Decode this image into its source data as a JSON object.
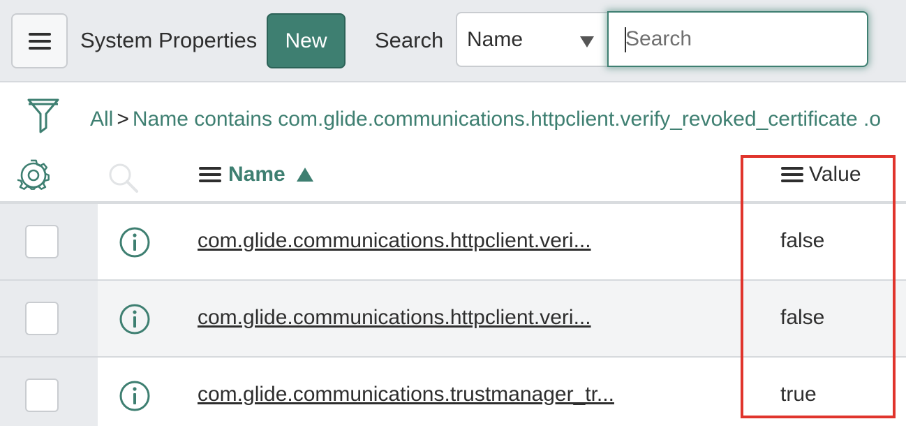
{
  "header": {
    "menu_icon": "hamburger-menu-icon",
    "title": "System Properties",
    "new_label": "New",
    "search_label": "Search",
    "search_field": {
      "selected": "Name"
    },
    "search_input": {
      "value": "",
      "placeholder": "Search"
    }
  },
  "breadcrumb": {
    "filter_icon": "funnel-icon",
    "all": "All",
    "separator": ">",
    "condition": "Name contains com.glide.communications.httpclient.verify_revoked_certificate .o"
  },
  "columns": {
    "settings_icon": "gear-icon",
    "search_icon": "magnifier-icon",
    "name": "Name",
    "value": "Value"
  },
  "rows": [
    {
      "name": "com.glide.communications.httpclient.veri...",
      "value": "false"
    },
    {
      "name": "com.glide.communications.httpclient.veri...",
      "value": "false"
    },
    {
      "name": "com.glide.communications.trustmanager_tr...",
      "value": "true"
    }
  ],
  "colors": {
    "accent": "#3e7f71",
    "highlight": "#e0342c",
    "header_bg": "#e9ebee"
  }
}
